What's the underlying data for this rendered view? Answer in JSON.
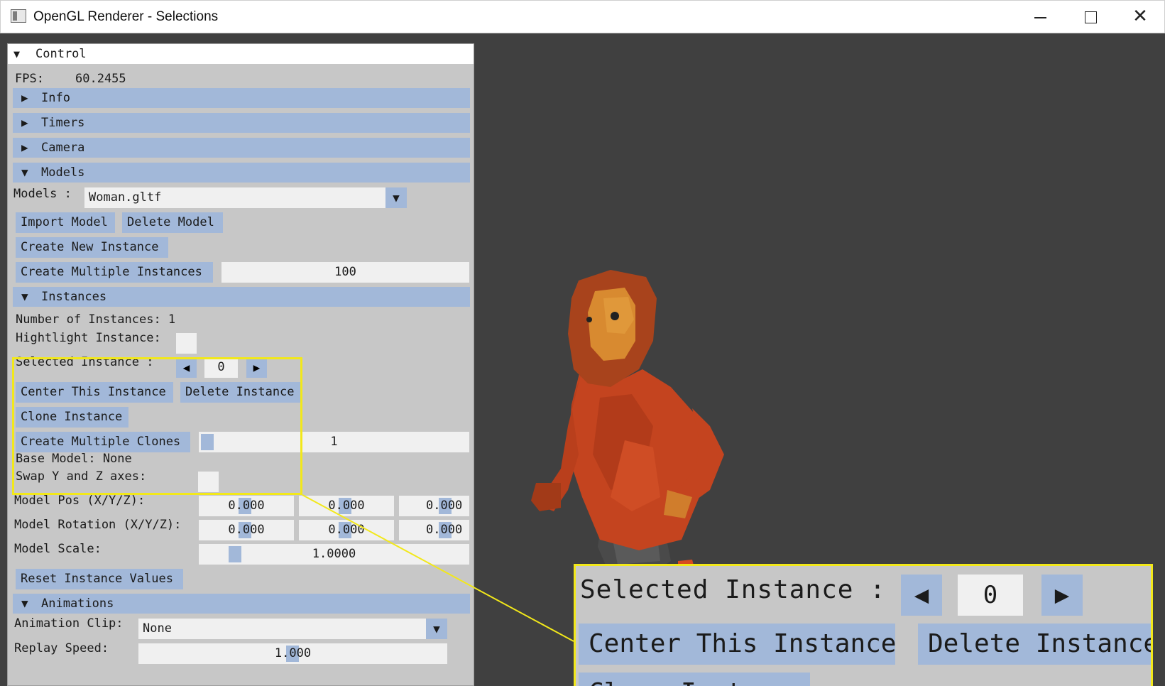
{
  "window": {
    "title": "OpenGL Renderer - Selections",
    "minimize": "minimize",
    "maximize": "maximize",
    "close": "✕"
  },
  "control": {
    "title_arrow": "▼",
    "title": "Control",
    "fps_label": "FPS:",
    "fps_value": "60.2455",
    "sections": {
      "info": {
        "arrow": "▶",
        "label": "Info"
      },
      "timers": {
        "arrow": "▶",
        "label": "Timers"
      },
      "camera": {
        "arrow": "▶",
        "label": "Camera"
      },
      "models": {
        "arrow": "▼",
        "label": "Models"
      },
      "instances": {
        "arrow": "▼",
        "label": "Instances"
      },
      "animations": {
        "arrow": "▼",
        "label": "Animations"
      }
    },
    "models": {
      "label": "Models :",
      "selected": "Woman.gltf",
      "dropdown_arrow": "▼",
      "import_button": "Import Model",
      "delete_button": "Delete Model",
      "create_instance_button": "Create New Instance",
      "create_multiple_button": "Create Multiple Instances",
      "multiple_count": "100"
    },
    "instances": {
      "count_label": "Number of Instances: 1",
      "highlight_label": "Hightlight Instance:",
      "selected_label": "Selected Instance  :",
      "prev_arrow": "◀",
      "selected_value": "0",
      "next_arrow": "▶",
      "center_button": "Center This Instance",
      "delete_button": "Delete Instance",
      "clone_button": "Clone Instance",
      "multiple_clones_button": "Create Multiple Clones",
      "clone_count": "1",
      "base_model": "Base Model: None",
      "swap_axes_label": "Swap Y and Z axes:",
      "pos_label": "Model Pos (X/Y/Z):",
      "pos_x": "0.000",
      "pos_y": "0.000",
      "pos_z": "0.000",
      "rot_label": "Model Rotation (X/Y/Z):",
      "rot_x": "0.000",
      "rot_y": "0.000",
      "rot_z": "0.000",
      "scale_label": "Model Scale:",
      "scale_value": "1.0000",
      "reset_button": "Reset Instance Values"
    },
    "animations": {
      "clip_label": "Animation Clip:",
      "clip_value": "None",
      "dropdown_arrow": "▼",
      "speed_label": "Replay Speed:",
      "speed_value": "1.000"
    }
  },
  "zoom_callout": {
    "selected_label": "Selected Instance  :",
    "prev_arrow": "◀",
    "selected_value": "0",
    "next_arrow": "▶",
    "center_button": "Center This Instance",
    "delete_button": "Delete Instance",
    "clone_button": "Clone Instance"
  },
  "colors": {
    "panel_bg": "#c7c7c7",
    "accent_blue": "#a2b8d9",
    "viewport_bg": "#404040",
    "highlight_yellow": "#f2e81a",
    "model_shirt": "#c4441f"
  }
}
